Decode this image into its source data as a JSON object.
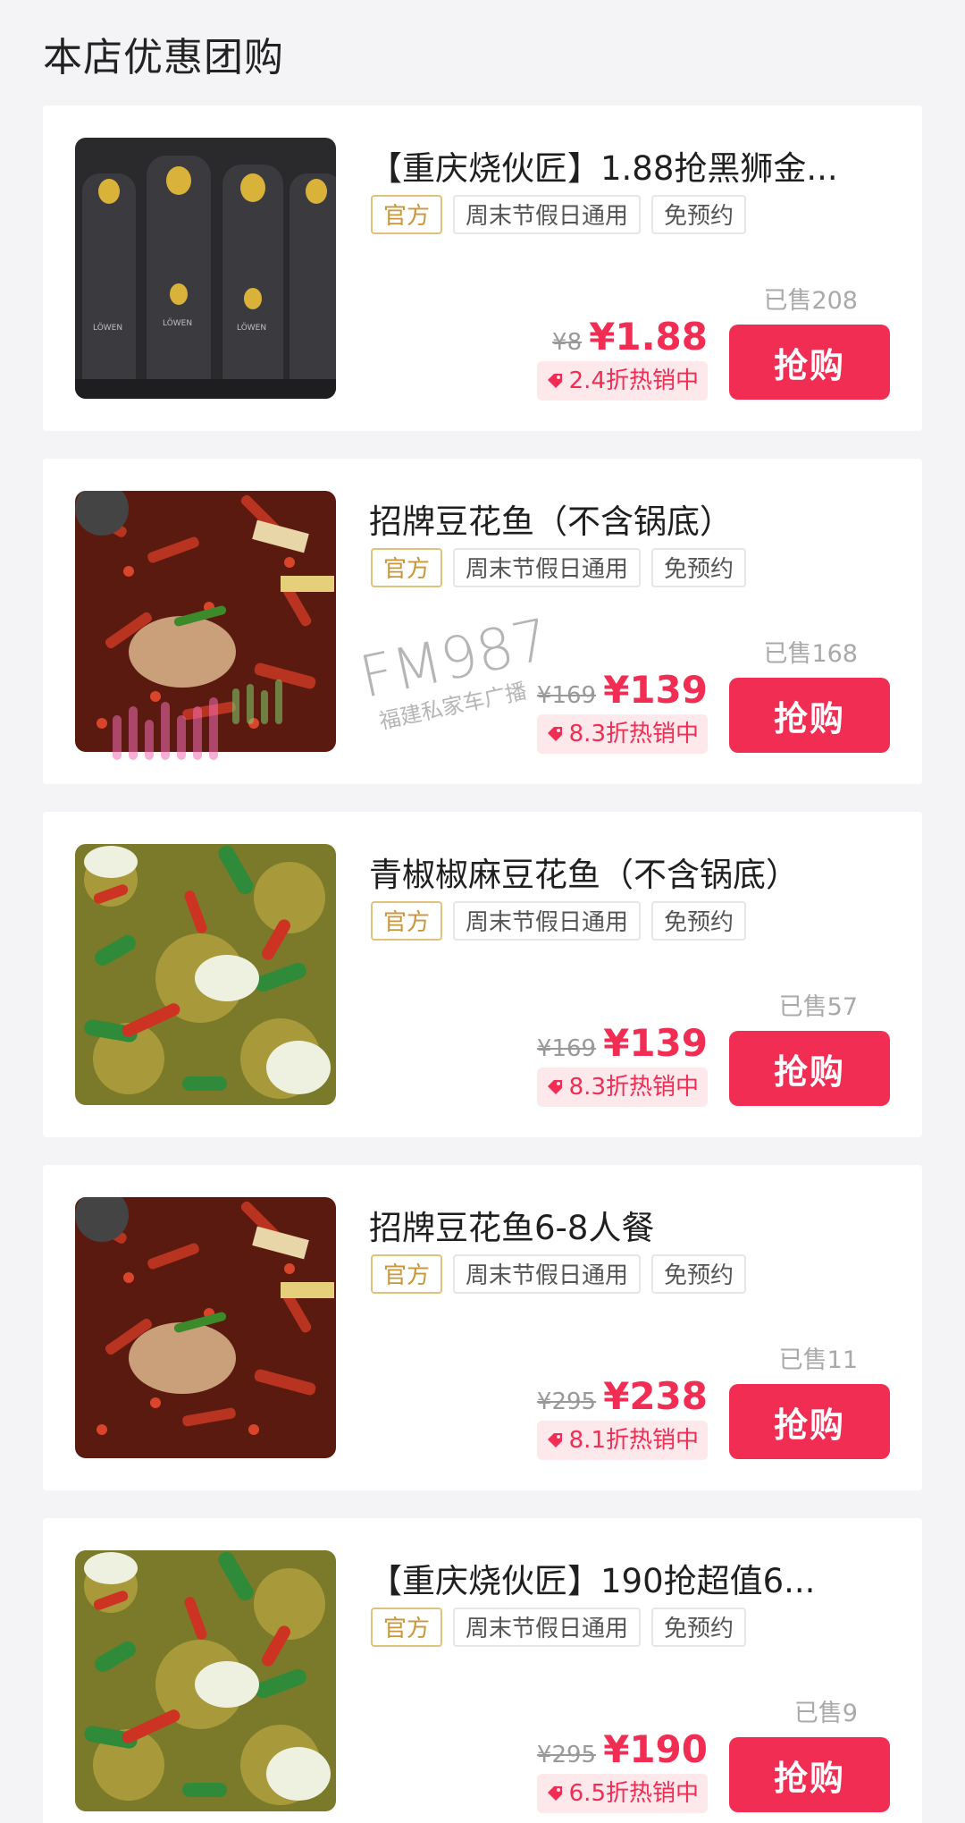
{
  "header": {
    "title": "本店优惠团购"
  },
  "tags": {
    "official": "官方",
    "holiday": "周末节假日通用",
    "no_reservation": "免预约"
  },
  "button_label": "抢购",
  "watermark": {
    "main": "FM987",
    "sub": "福建私家车广播"
  },
  "colors": {
    "accent": "#f12d54",
    "official_tag": "#c9963a",
    "background": "#f4f4f6"
  },
  "deals": [
    {
      "title": "【重庆烧伙匠】1.88抢黑狮金...",
      "image": "beer-bottles-image",
      "sold": "已售208",
      "original_price": "¥8",
      "price": "¥1.88",
      "discount": "2.4折热销中"
    },
    {
      "title": "招牌豆花鱼（不含锅底）",
      "image": "spicy-fish-hotpot-image",
      "sold": "已售168",
      "original_price": "¥169",
      "price": "¥139",
      "discount": "8.3折热销中"
    },
    {
      "title": "青椒椒麻豆花鱼（不含锅底）",
      "image": "green-pepper-fish-image",
      "sold": "已售57",
      "original_price": "¥169",
      "price": "¥139",
      "discount": "8.3折热销中"
    },
    {
      "title": "招牌豆花鱼6-8人餐",
      "image": "spicy-fish-hotpot-image",
      "sold": "已售11",
      "original_price": "¥295",
      "price": "¥238",
      "discount": "8.1折热销中"
    },
    {
      "title": "【重庆烧伙匠】190抢超值6...",
      "image": "green-pepper-fish-image",
      "sold": "已售9",
      "original_price": "¥295",
      "price": "¥190",
      "discount": "6.5折热销中"
    }
  ]
}
